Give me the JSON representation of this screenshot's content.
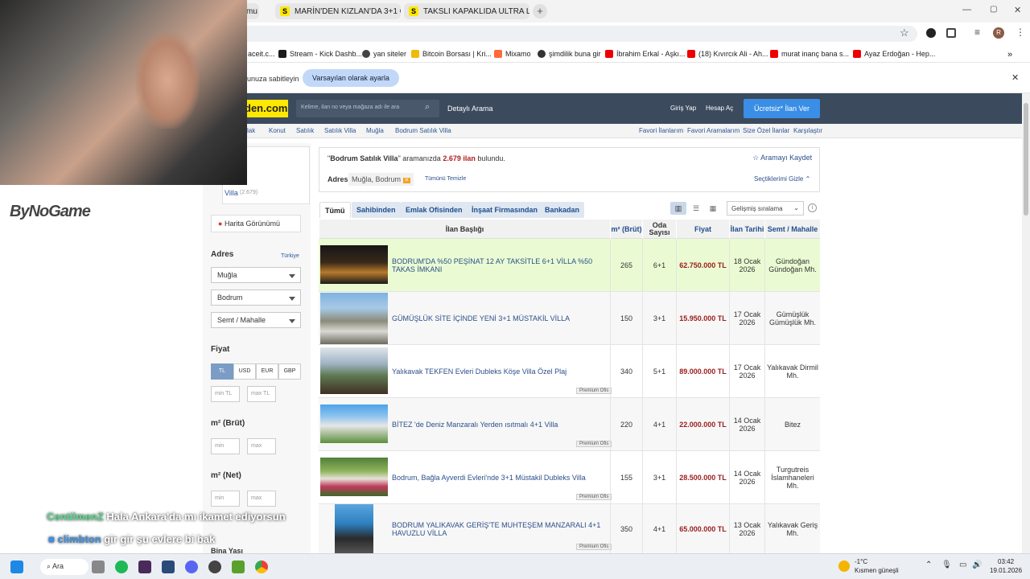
{
  "browser": {
    "tabs": [
      {
        "label": "mu",
        "fav": ""
      },
      {
        "label": "MARİN'DEN KIZLAN'DA 3+1 Ö",
        "fav": "S"
      },
      {
        "label": "TAKSLI KAPAKLIDA ULTRA LÜKS",
        "fav": "S"
      }
    ],
    "bookmarks": [
      "aceit.c...",
      "Stream - Kick Dashb...",
      "yan siteler",
      "Bitcoin Borsası | Kri...",
      "Mixamo",
      "şimdilik buna gir",
      "İbrahim Erkal - Aşkı...",
      "(18) Kıvırcık Ali - Ah...",
      "murat inanç bana s...",
      "Ayaz Erdoğan - Hep..."
    ],
    "infobar_text": "unuza sabitleyin",
    "infobar_button": "Varsayılan olarak ayarla",
    "profile_letter": "R"
  },
  "site": {
    "logo": "den.com",
    "search_placeholder": "Kelime, ilan no veya mağaza adı ile ara",
    "detailed_search": "Detaylı Arama",
    "login": "Giriş Yap",
    "register": "Hesap Aç",
    "post_ad": "Ücretsiz* İlan Ver",
    "breadcrumb": [
      "lak",
      "Konut",
      "Satılık",
      "Satılık Villa",
      "Muğla",
      "Bodrum Satılık Villa"
    ],
    "crumb_links": [
      "Favori İlanlarım",
      "Favori Aramalarım",
      "Size Özel İlanlar",
      "Karşılaştır"
    ]
  },
  "sidebar": {
    "category": "Villa",
    "category_count": "(2.679)",
    "map_view": "Harita Görünümü",
    "address_label": "Adres",
    "country": "Türkiye",
    "city": "Muğla",
    "district": "Bodrum",
    "neighborhood": "Semt / Mahalle",
    "price_label": "Fiyat",
    "currencies": [
      "TL",
      "USD",
      "EUR",
      "GBP"
    ],
    "min_tl": "min TL",
    "max_tl": "max TL",
    "m2_brut": "m² (Brüt)",
    "m2_net": "m² (Net)",
    "min": "min",
    "max": "max",
    "bina_yasi": "Bina Yaşı"
  },
  "results": {
    "query": "Bodrum Satılık Villa",
    "search_text": "aramanızda",
    "count": "2.679 ilan",
    "found": "bulundu.",
    "save_search": "Aramayı Kaydet",
    "address_label": "Adres",
    "address_value": "Muğla, Bodrum",
    "clear_all": "Tümünü Temizle",
    "hide_selections": "Seçtiklerimi Gizle",
    "tabs": [
      "Tümü",
      "Sahibinden",
      "Emlak Ofisinden",
      "İnşaat Firmasından",
      "Bankadan"
    ],
    "sort": "Gelişmiş sıralama",
    "columns": [
      "İlan Başlığı",
      "m² (Brüt)",
      "Oda Sayısı",
      "Fiyat",
      "İlan Tarihi",
      "Semt / Mahalle"
    ],
    "premium": "Premium Ofis",
    "rows": [
      {
        "title": "BODRUM'DA %50 PEŞİNAT 12 AY TAKSİTLE 6+1 VİLLA %50 TAKAS İMKANI",
        "m2": "265",
        "rooms": "6+1",
        "price": "62.750.000 TL",
        "date": "18 Ocak 2026",
        "loc": "Gündoğan Gündoğan Mh."
      },
      {
        "title": "GÜMÜŞLÜK SİTE İÇİNDE YENİ 3+1 MÜSTAKİL VİLLA",
        "m2": "150",
        "rooms": "3+1",
        "price": "15.950.000 TL",
        "date": "17 Ocak 2026",
        "loc": "Gümüşlük Gümüşlük Mh."
      },
      {
        "title": "Yalıkavak TEKFEN Evleri Dubleks Köşe Villa Özel Plaj",
        "m2": "340",
        "rooms": "5+1",
        "price": "89.000.000 TL",
        "date": "17 Ocak 2026",
        "loc": "Yalıkavak Dirmil Mh."
      },
      {
        "title": "BİTEZ 'de Deniz Manzaralı Yerden ısıtmalı 4+1 Villa",
        "m2": "220",
        "rooms": "4+1",
        "price": "22.000.000 TL",
        "date": "14 Ocak 2026",
        "loc": "Bitez"
      },
      {
        "title": "Bodrum, Bağla Ayverdi Evleri'nde 3+1 Müstakil Dubleks Villa",
        "m2": "155",
        "rooms": "3+1",
        "price": "28.500.000 TL",
        "date": "14 Ocak 2026",
        "loc": "Turgutreis İslamhaneleri Mh."
      },
      {
        "title": "BODRUM YALIKAVAK GERİŞ'TE MUHTEŞEM MANZARALI 4+1 HAVUZLU VİLLA",
        "m2": "350",
        "rooms": "4+1",
        "price": "65.000.000 TL",
        "date": "13 Ocak 2026",
        "loc": "Yalıkavak Geriş Mh."
      }
    ]
  },
  "stream": {
    "watermark": "ByNoGame",
    "chat": [
      {
        "user": "CentilmenZ",
        "msg": "Hala Ankara'da mı ikamet ediyorsun"
      },
      {
        "user": "climbton",
        "msg": "gir gir şu evlere bi bak"
      }
    ]
  },
  "taskbar": {
    "search": "Ara",
    "weather_temp": "-1°C",
    "weather_desc": "Kısmen güneşli",
    "time": "03:42",
    "date": "19.01.2026"
  }
}
